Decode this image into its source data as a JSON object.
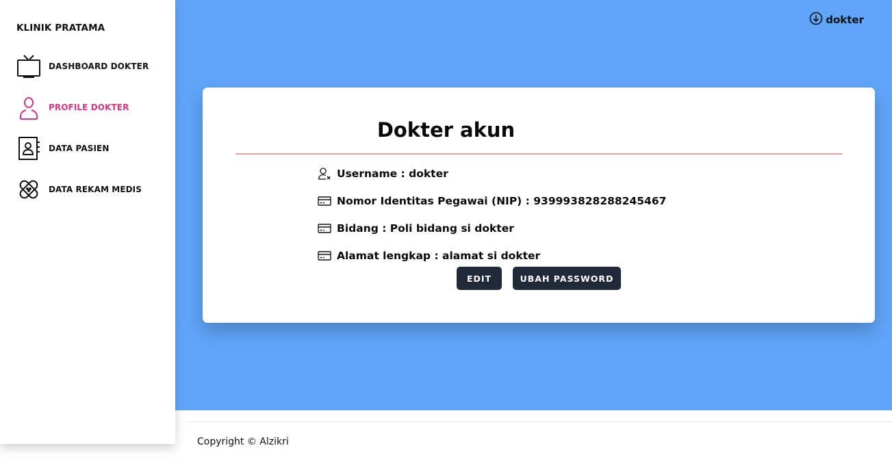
{
  "sidebar": {
    "brand": "KLINIK PRATAMA",
    "items": [
      {
        "label": "DASHBOARD DOKTER",
        "icon": "tv-icon"
      },
      {
        "label": "PROFILE DOKTER",
        "icon": "user-icon",
        "active": true
      },
      {
        "label": "DATA PASIEN",
        "icon": "contact-book-icon"
      },
      {
        "label": "DATA REKAM MEDIS",
        "icon": "bandage-icon"
      }
    ]
  },
  "header": {
    "user_label": "dokter",
    "user_icon": "arrow-down-circle-icon"
  },
  "card": {
    "title": "Dokter akun",
    "rows": [
      {
        "icon": "user-x-icon",
        "text": "Username : dokter"
      },
      {
        "icon": "credit-card-icon",
        "text": "Nomor Identitas Pegawai (NIP) : 939993828288245467"
      },
      {
        "icon": "credit-card-icon",
        "text": "Bidang : Poli bidang si dokter"
      },
      {
        "icon": "credit-card-icon",
        "text": "Alamat lengkap : alamat si dokter"
      }
    ],
    "edit_label": "EDIT",
    "change_password_label": "UBAH PASSWORD"
  },
  "footer": {
    "copyright": "Copyright © Alzikri"
  },
  "colors": {
    "hero": "#60a5fa",
    "active_nav": "#d63384",
    "button": "#1f2937",
    "divider": "#f0a0a0"
  }
}
